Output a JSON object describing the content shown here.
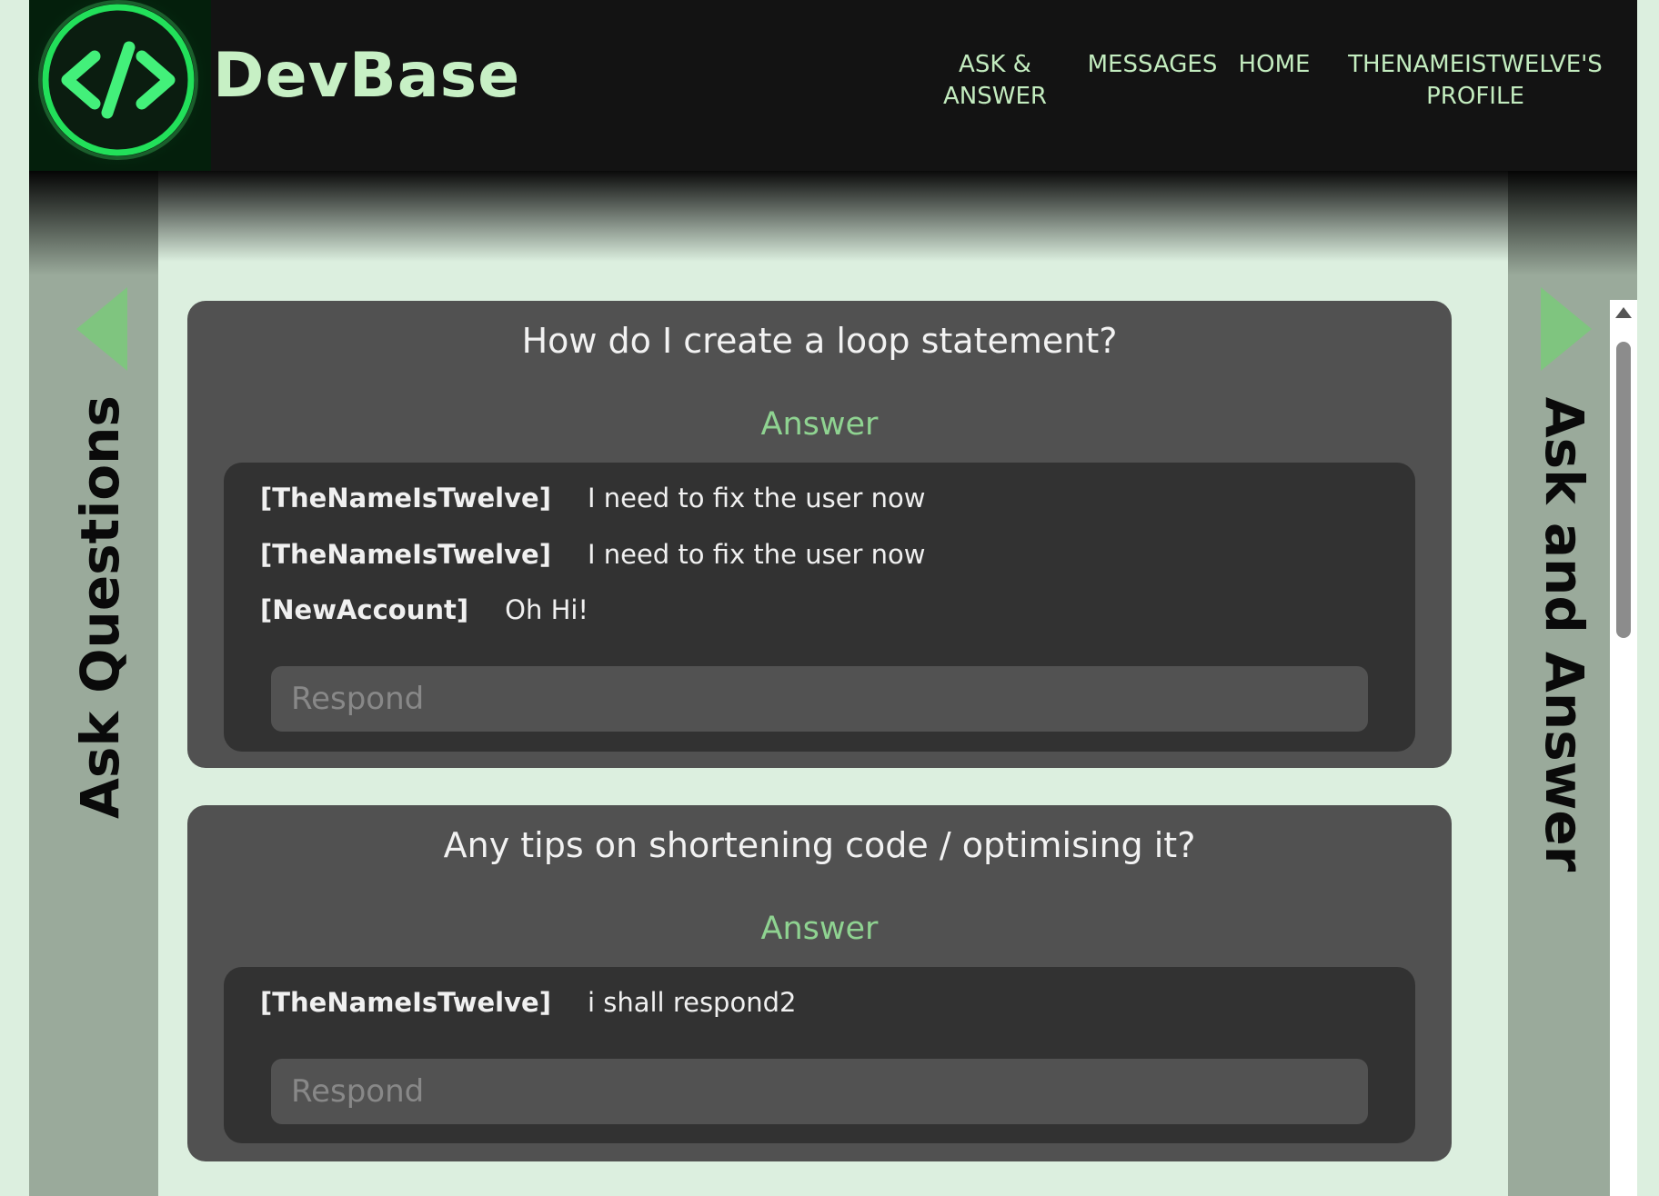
{
  "header": {
    "brand": "DevBase",
    "logo_icon": "code-brackets-icon",
    "nav": [
      {
        "label_line1": "ASK &",
        "label_line2": "ANSWER"
      },
      {
        "label_line1": "MESSAGES",
        "label_line2": ""
      },
      {
        "label_line1": "HOME",
        "label_line2": ""
      },
      {
        "label_line1": "THENAMEISTWELVE'S",
        "label_line2": "PROFILE"
      }
    ]
  },
  "left_panel": {
    "label": "Ask Questions",
    "arrow_icon": "arrow-left-icon"
  },
  "right_panel": {
    "label": "Ask and Answer",
    "arrow_icon": "arrow-right-icon"
  },
  "questions": [
    {
      "title": "How do I create a loop statement?",
      "answer_label": "Answer",
      "answers": [
        {
          "user": "[TheNameIsTwelve]",
          "text": "I need to fix the user now"
        },
        {
          "user": "[TheNameIsTwelve]",
          "text": "I need to fix the user now"
        },
        {
          "user": "[NewAccount]",
          "text": "Oh Hi!"
        }
      ],
      "respond_placeholder": "Respond"
    },
    {
      "title": "Any tips on shortening code / optimising it?",
      "answer_label": "Answer",
      "answers": [
        {
          "user": "[TheNameIsTwelve]",
          "text": "i shall respond2"
        }
      ],
      "respond_placeholder": "Respond"
    }
  ],
  "colors": {
    "accent_green": "#8fd391",
    "header_bg": "#131313",
    "page_bg": "#dcefdf",
    "card_bg": "#515151",
    "inner_bg": "#323232",
    "brand_text": "#c7f0c5"
  }
}
